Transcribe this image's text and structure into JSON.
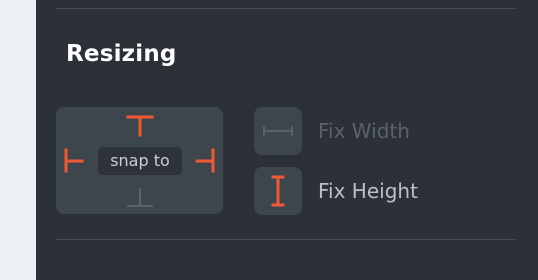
{
  "section": {
    "title": "Resizing"
  },
  "snap": {
    "label": "snap to",
    "top": "active",
    "left": "active",
    "right": "active",
    "bottom": "inactive"
  },
  "fix_width": {
    "label": "Fix Width",
    "icon": "horizontal-resize-icon",
    "state": "disabled"
  },
  "fix_height": {
    "label": "Fix Height",
    "icon": "vertical-resize-icon",
    "state": "active"
  },
  "colors": {
    "panel_bg": "#2c3137",
    "control_bg": "#3d454d",
    "accent": "#f05a32",
    "inactive": "#5b646d",
    "title": "#ffffff",
    "label_text": "#c9ced4"
  }
}
